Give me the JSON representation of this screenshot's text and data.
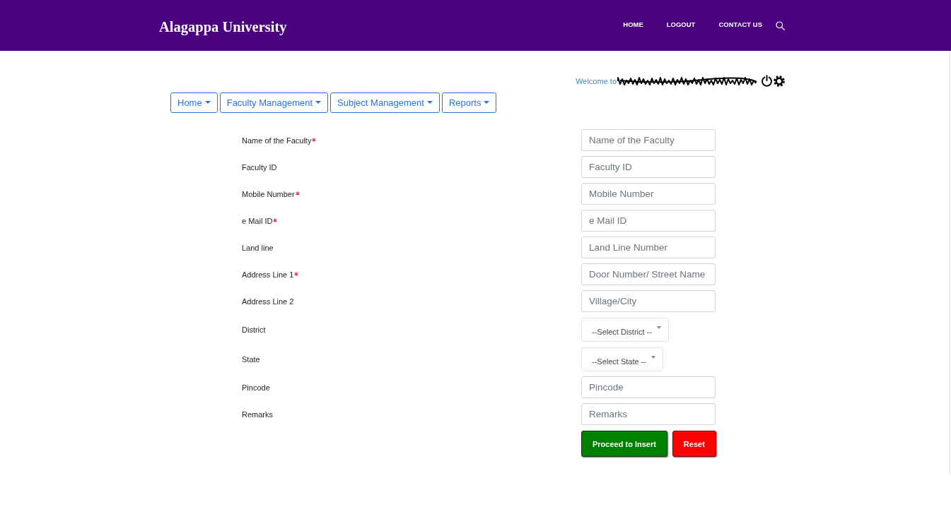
{
  "header": {
    "logo": "Alagappa University",
    "nav": [
      "HOME",
      "LOGOUT",
      "CONTACT US"
    ]
  },
  "welcome": {
    "text": "Welcome to",
    "user_name_redacted": true
  },
  "menu": [
    {
      "label": "Home"
    },
    {
      "label": "Faculty Management"
    },
    {
      "label": "Subject Management"
    },
    {
      "label": "Reports"
    }
  ],
  "form": {
    "fields": [
      {
        "label": "Name of the Faculty",
        "required": true,
        "kind": "input",
        "placeholder": "Name of the Faculty"
      },
      {
        "label": "Faculty ID",
        "required": false,
        "kind": "input",
        "placeholder": "Faculty ID"
      },
      {
        "label": "Mobile Number",
        "required": true,
        "kind": "input",
        "placeholder": "Mobile Number"
      },
      {
        "label": "e Mail ID",
        "required": true,
        "kind": "input",
        "placeholder": "e Mail ID"
      },
      {
        "label": "Land line",
        "required": false,
        "kind": "input",
        "placeholder": "Land Line Number"
      },
      {
        "label": "Address Line 1",
        "required": true,
        "kind": "input",
        "placeholder": "Door Number/ Street Name"
      },
      {
        "label": "Address Line 2",
        "required": false,
        "kind": "input",
        "placeholder": "Village/City"
      },
      {
        "label": "District",
        "required": false,
        "kind": "select",
        "value": "--Select District --"
      },
      {
        "label": "State",
        "required": false,
        "kind": "select",
        "value": "--Select State --"
      },
      {
        "label": "Pincode",
        "required": false,
        "kind": "input",
        "placeholder": "Pincode"
      },
      {
        "label": "Remarks",
        "required": false,
        "kind": "input",
        "placeholder": "Remarks"
      }
    ],
    "buttons": [
      {
        "label": "Proceed to Insert",
        "kind": "submit"
      },
      {
        "label": "Reset",
        "kind": "reset"
      }
    ]
  }
}
